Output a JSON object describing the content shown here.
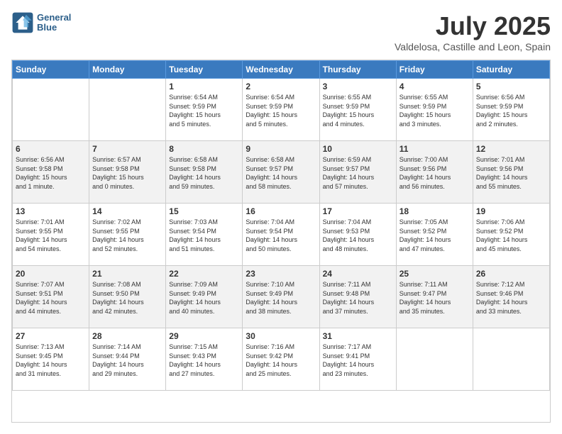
{
  "header": {
    "logo_line1": "General",
    "logo_line2": "Blue",
    "title": "July 2025",
    "subtitle": "Valdelosa, Castille and Leon, Spain"
  },
  "calendar": {
    "days_of_week": [
      "Sunday",
      "Monday",
      "Tuesday",
      "Wednesday",
      "Thursday",
      "Friday",
      "Saturday"
    ],
    "weeks": [
      [
        {
          "day": "",
          "info": ""
        },
        {
          "day": "",
          "info": ""
        },
        {
          "day": "1",
          "info": "Sunrise: 6:54 AM\nSunset: 9:59 PM\nDaylight: 15 hours\nand 5 minutes."
        },
        {
          "day": "2",
          "info": "Sunrise: 6:54 AM\nSunset: 9:59 PM\nDaylight: 15 hours\nand 5 minutes."
        },
        {
          "day": "3",
          "info": "Sunrise: 6:55 AM\nSunset: 9:59 PM\nDaylight: 15 hours\nand 4 minutes."
        },
        {
          "day": "4",
          "info": "Sunrise: 6:55 AM\nSunset: 9:59 PM\nDaylight: 15 hours\nand 3 minutes."
        },
        {
          "day": "5",
          "info": "Sunrise: 6:56 AM\nSunset: 9:59 PM\nDaylight: 15 hours\nand 2 minutes."
        }
      ],
      [
        {
          "day": "6",
          "info": "Sunrise: 6:56 AM\nSunset: 9:58 PM\nDaylight: 15 hours\nand 1 minute."
        },
        {
          "day": "7",
          "info": "Sunrise: 6:57 AM\nSunset: 9:58 PM\nDaylight: 15 hours\nand 0 minutes."
        },
        {
          "day": "8",
          "info": "Sunrise: 6:58 AM\nSunset: 9:58 PM\nDaylight: 14 hours\nand 59 minutes."
        },
        {
          "day": "9",
          "info": "Sunrise: 6:58 AM\nSunset: 9:57 PM\nDaylight: 14 hours\nand 58 minutes."
        },
        {
          "day": "10",
          "info": "Sunrise: 6:59 AM\nSunset: 9:57 PM\nDaylight: 14 hours\nand 57 minutes."
        },
        {
          "day": "11",
          "info": "Sunrise: 7:00 AM\nSunset: 9:56 PM\nDaylight: 14 hours\nand 56 minutes."
        },
        {
          "day": "12",
          "info": "Sunrise: 7:01 AM\nSunset: 9:56 PM\nDaylight: 14 hours\nand 55 minutes."
        }
      ],
      [
        {
          "day": "13",
          "info": "Sunrise: 7:01 AM\nSunset: 9:55 PM\nDaylight: 14 hours\nand 54 minutes."
        },
        {
          "day": "14",
          "info": "Sunrise: 7:02 AM\nSunset: 9:55 PM\nDaylight: 14 hours\nand 52 minutes."
        },
        {
          "day": "15",
          "info": "Sunrise: 7:03 AM\nSunset: 9:54 PM\nDaylight: 14 hours\nand 51 minutes."
        },
        {
          "day": "16",
          "info": "Sunrise: 7:04 AM\nSunset: 9:54 PM\nDaylight: 14 hours\nand 50 minutes."
        },
        {
          "day": "17",
          "info": "Sunrise: 7:04 AM\nSunset: 9:53 PM\nDaylight: 14 hours\nand 48 minutes."
        },
        {
          "day": "18",
          "info": "Sunrise: 7:05 AM\nSunset: 9:52 PM\nDaylight: 14 hours\nand 47 minutes."
        },
        {
          "day": "19",
          "info": "Sunrise: 7:06 AM\nSunset: 9:52 PM\nDaylight: 14 hours\nand 45 minutes."
        }
      ],
      [
        {
          "day": "20",
          "info": "Sunrise: 7:07 AM\nSunset: 9:51 PM\nDaylight: 14 hours\nand 44 minutes."
        },
        {
          "day": "21",
          "info": "Sunrise: 7:08 AM\nSunset: 9:50 PM\nDaylight: 14 hours\nand 42 minutes."
        },
        {
          "day": "22",
          "info": "Sunrise: 7:09 AM\nSunset: 9:49 PM\nDaylight: 14 hours\nand 40 minutes."
        },
        {
          "day": "23",
          "info": "Sunrise: 7:10 AM\nSunset: 9:49 PM\nDaylight: 14 hours\nand 38 minutes."
        },
        {
          "day": "24",
          "info": "Sunrise: 7:11 AM\nSunset: 9:48 PM\nDaylight: 14 hours\nand 37 minutes."
        },
        {
          "day": "25",
          "info": "Sunrise: 7:11 AM\nSunset: 9:47 PM\nDaylight: 14 hours\nand 35 minutes."
        },
        {
          "day": "26",
          "info": "Sunrise: 7:12 AM\nSunset: 9:46 PM\nDaylight: 14 hours\nand 33 minutes."
        }
      ],
      [
        {
          "day": "27",
          "info": "Sunrise: 7:13 AM\nSunset: 9:45 PM\nDaylight: 14 hours\nand 31 minutes."
        },
        {
          "day": "28",
          "info": "Sunrise: 7:14 AM\nSunset: 9:44 PM\nDaylight: 14 hours\nand 29 minutes."
        },
        {
          "day": "29",
          "info": "Sunrise: 7:15 AM\nSunset: 9:43 PM\nDaylight: 14 hours\nand 27 minutes."
        },
        {
          "day": "30",
          "info": "Sunrise: 7:16 AM\nSunset: 9:42 PM\nDaylight: 14 hours\nand 25 minutes."
        },
        {
          "day": "31",
          "info": "Sunrise: 7:17 AM\nSunset: 9:41 PM\nDaylight: 14 hours\nand 23 minutes."
        },
        {
          "day": "",
          "info": ""
        },
        {
          "day": "",
          "info": ""
        }
      ]
    ]
  }
}
